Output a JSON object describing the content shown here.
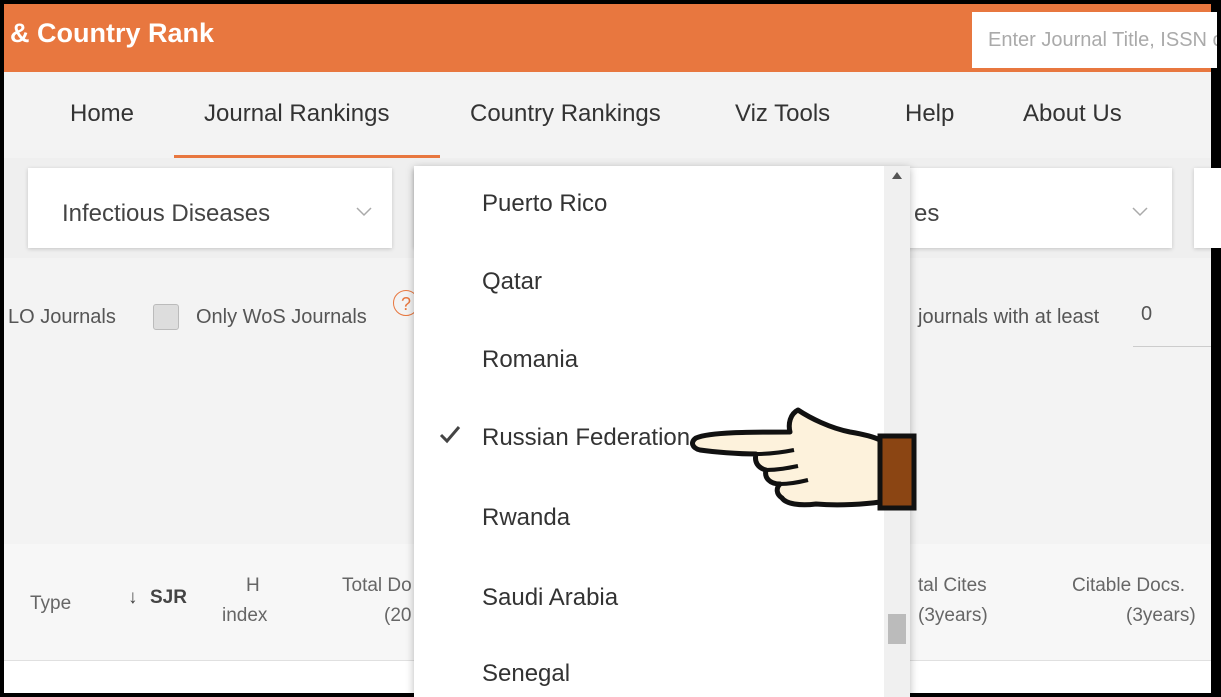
{
  "header": {
    "brand": "& Country Rank",
    "search_placeholder": "Enter Journal Title, ISSN or Publisher Name"
  },
  "nav": {
    "items": [
      "Home",
      "Journal Rankings",
      "Country Rankings",
      "Viz Tools",
      "Help",
      "About Us"
    ],
    "active": "Journal Rankings"
  },
  "filters": {
    "category": "Infectious Diseases",
    "type_partial": "es"
  },
  "options": {
    "scielo_partial": "LO Journals",
    "wos_label": "Only WoS Journals",
    "help_glyph": "?",
    "min_cites_label": "journals with at least",
    "min_cites_value": "0"
  },
  "table_header": {
    "type": "Type",
    "sort_arrow": "↓",
    "sjr": "SJR",
    "h": "H",
    "index": "index",
    "total_docs_1": "Total Do",
    "total_docs_2": "(20",
    "total_cites_1": "tal Cites",
    "total_cites_2": "(3years)",
    "citable_1": "Citable Docs.",
    "citable_2": "(3years)"
  },
  "country_dropdown": {
    "items": [
      "Puerto Rico",
      "Qatar",
      "Romania",
      "Russian Federation",
      "Rwanda",
      "Saudi Arabia",
      "Senegal"
    ],
    "selected": "Russian Federation"
  },
  "colors": {
    "accent": "#e8773f",
    "hand_fill": "#fdf2dc",
    "cuff": "#8b4513"
  },
  "icons": {
    "chevron": "chevron-down-icon",
    "check": "check-icon",
    "pointer": "pointing-hand-icon"
  }
}
